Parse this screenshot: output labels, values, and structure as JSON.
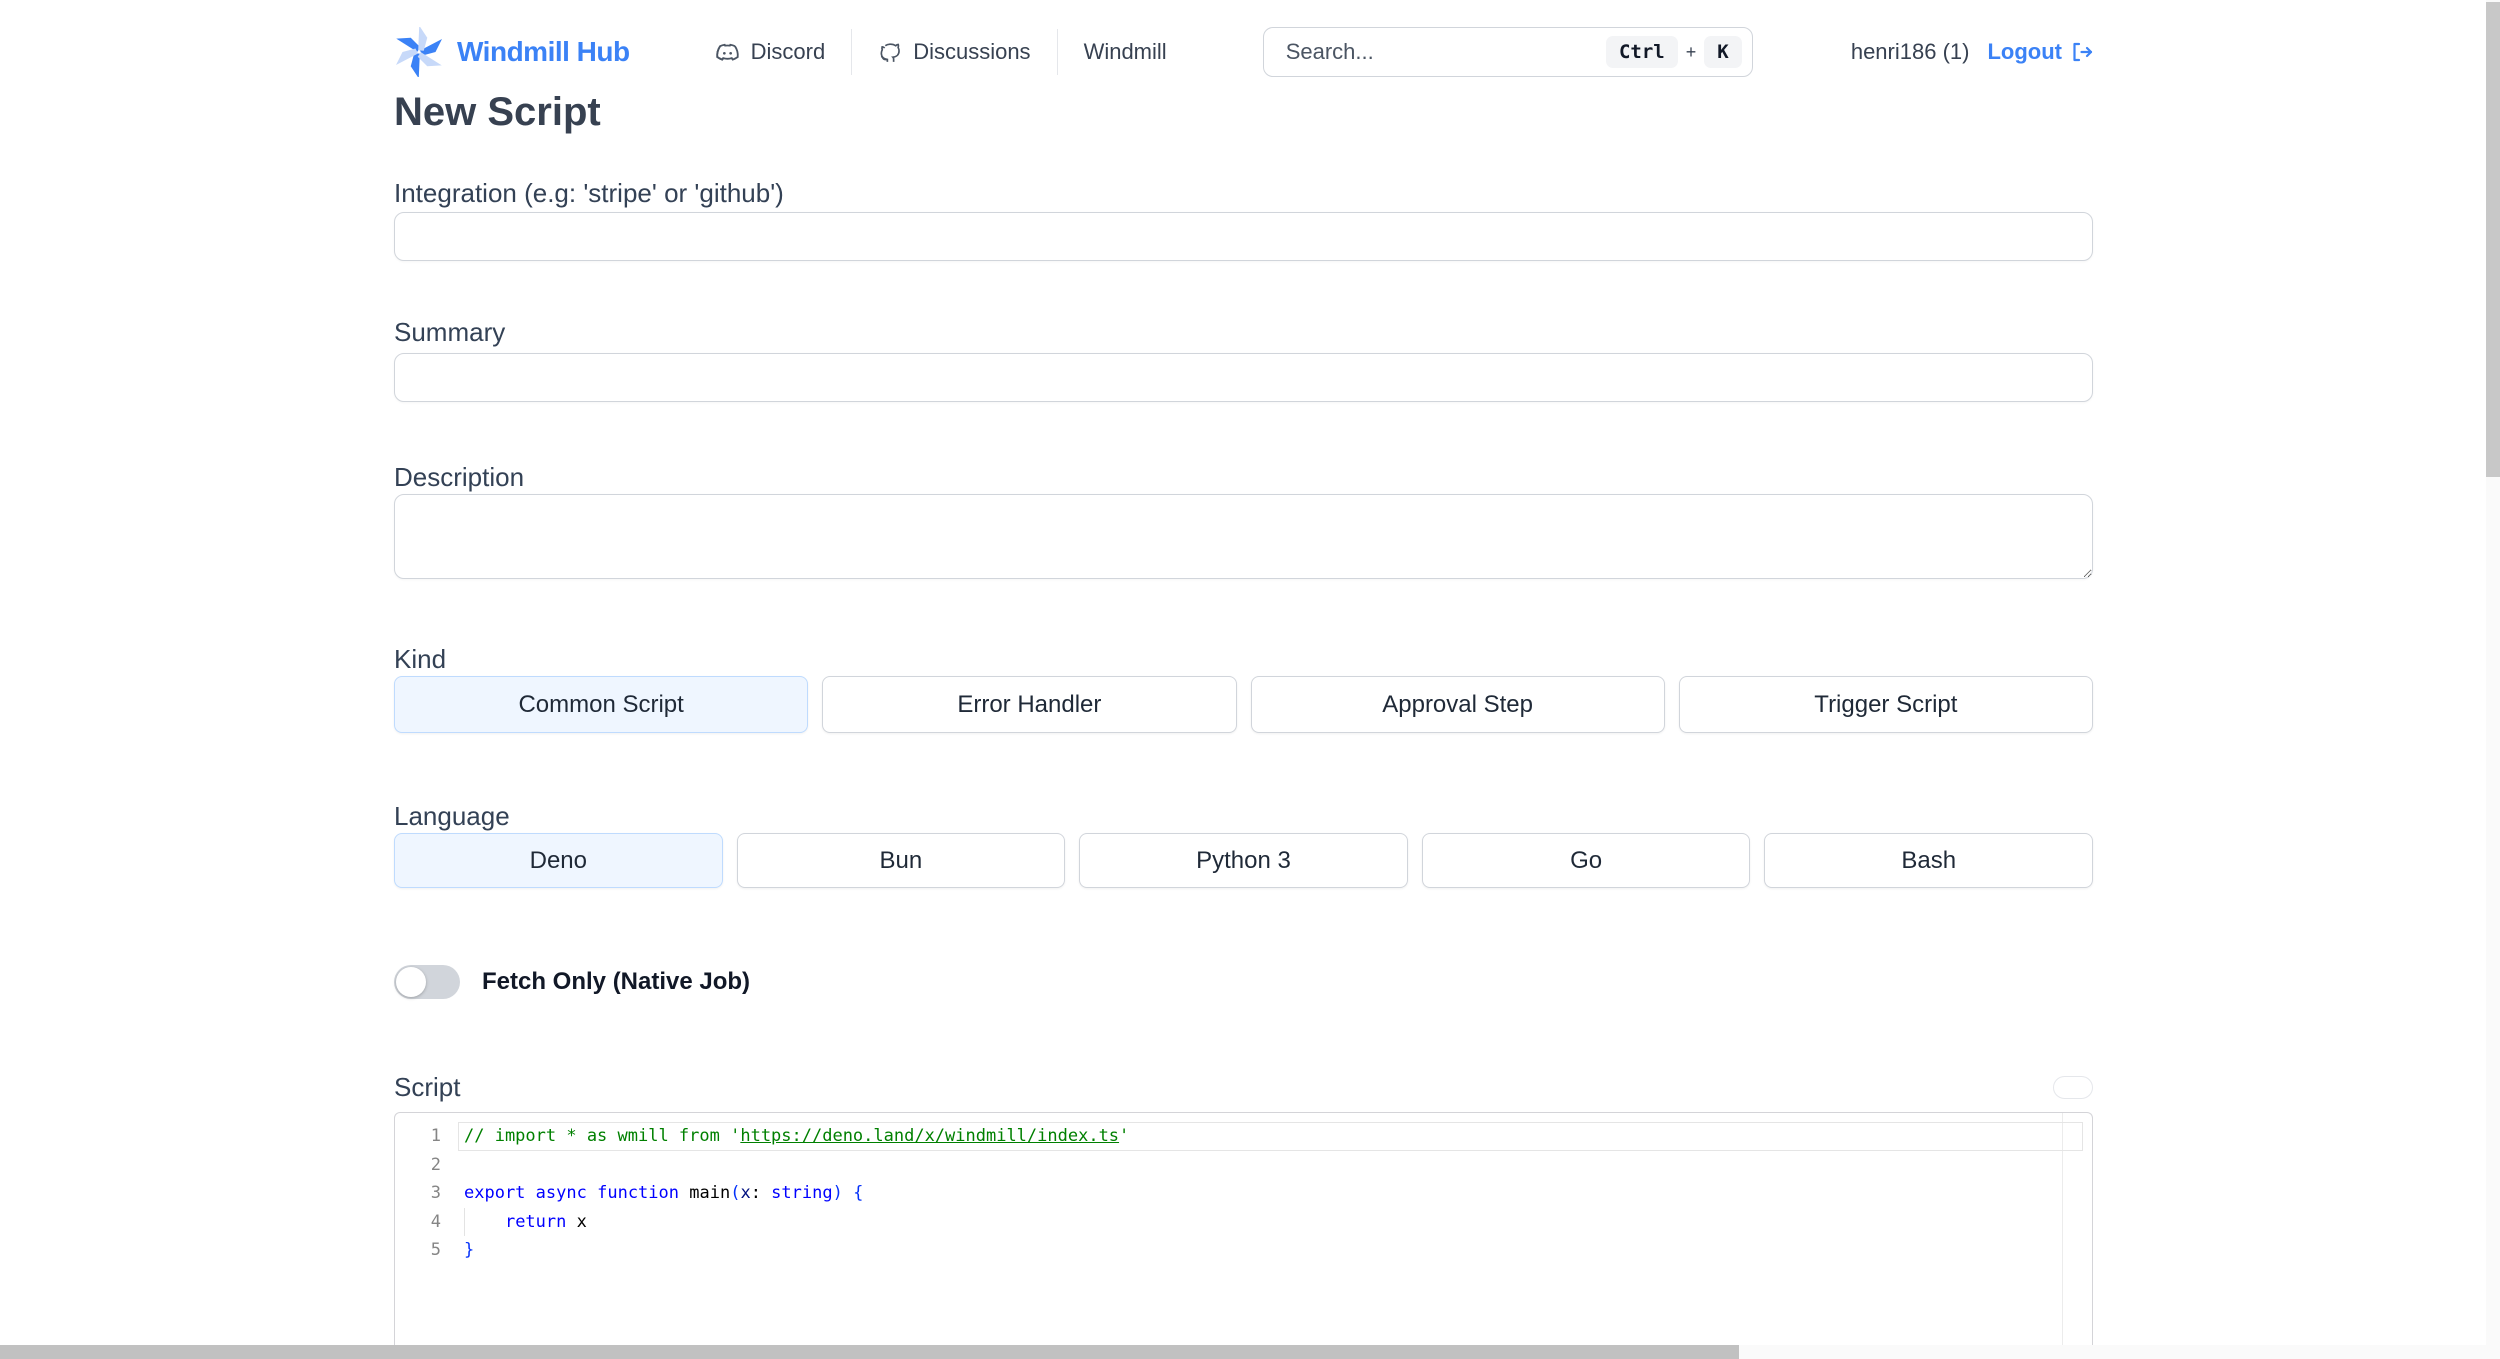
{
  "header": {
    "brand": "Windmill Hub",
    "nav": [
      {
        "label": "Discord",
        "icon": "discord-icon"
      },
      {
        "label": "Discussions",
        "icon": "github-icon"
      },
      {
        "label": "Windmill",
        "icon": null
      }
    ],
    "search": {
      "placeholder": "Search...",
      "shortcut_keys": [
        "Ctrl",
        "K"
      ],
      "shortcut_separator": "+"
    },
    "user": {
      "name": "henri186 (1)",
      "logout_label": "Logout"
    }
  },
  "page": {
    "title": "New Script"
  },
  "form": {
    "integration": {
      "label": "Integration (e.g: 'stripe' or 'github')",
      "value": ""
    },
    "summary": {
      "label": "Summary",
      "value": ""
    },
    "description": {
      "label": "Description",
      "value": ""
    },
    "kind": {
      "label": "Kind",
      "options": [
        "Common Script",
        "Error Handler",
        "Approval Step",
        "Trigger Script"
      ],
      "selected": "Common Script"
    },
    "language": {
      "label": "Language",
      "options": [
        "Deno",
        "Bun",
        "Python 3",
        "Go",
        "Bash"
      ],
      "selected": "Deno"
    },
    "fetch_only": {
      "label": "Fetch Only (Native Job)",
      "enabled": false
    },
    "script": {
      "label": "Script"
    }
  },
  "editor": {
    "language": "typescript",
    "lines": [
      {
        "number": "1",
        "current": true,
        "indent_guide": false,
        "tokens": [
          {
            "t": "// import * as wmill from '",
            "c": "comment"
          },
          {
            "t": "https://deno.land/x/windmill/index.ts",
            "c": "comment link"
          },
          {
            "t": "'",
            "c": "comment"
          }
        ]
      },
      {
        "number": "2",
        "current": false,
        "indent_guide": false,
        "tokens": []
      },
      {
        "number": "3",
        "current": false,
        "indent_guide": false,
        "tokens": [
          {
            "t": "export",
            "c": "kw"
          },
          {
            "t": " ",
            "c": "plain"
          },
          {
            "t": "async",
            "c": "kw"
          },
          {
            "t": " ",
            "c": "plain"
          },
          {
            "t": "function",
            "c": "kw"
          },
          {
            "t": " main",
            "c": "plain"
          },
          {
            "t": "(",
            "c": "bracket"
          },
          {
            "t": "x",
            "c": "param"
          },
          {
            "t": ": ",
            "c": "plain"
          },
          {
            "t": "string",
            "c": "kw"
          },
          {
            "t": ")",
            "c": "bracket"
          },
          {
            "t": " ",
            "c": "plain"
          },
          {
            "t": "{",
            "c": "bracket"
          }
        ]
      },
      {
        "number": "4",
        "current": false,
        "indent_guide": true,
        "tokens": [
          {
            "t": "    ",
            "c": "plain"
          },
          {
            "t": "return",
            "c": "kw"
          },
          {
            "t": " x",
            "c": "plain"
          }
        ]
      },
      {
        "number": "5",
        "current": false,
        "indent_guide": false,
        "tokens": [
          {
            "t": "}",
            "c": "bracket"
          }
        ]
      }
    ]
  },
  "colors": {
    "accent": "#3b82f6",
    "selected_bg": "#eff6ff",
    "selected_border": "#bfdbfe",
    "comment_green": "#008000",
    "keyword_blue": "#0000ff",
    "scrollbar_thumb": "#c1c1c1"
  }
}
